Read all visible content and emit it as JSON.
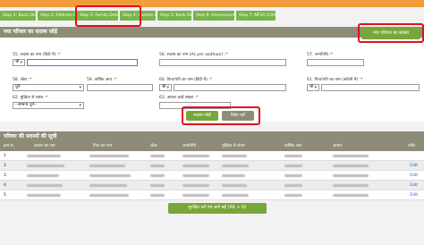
{
  "steps": [
    "Step 1: Basic Details",
    "Step 2: Address Details",
    "Step 3: Family Details",
    "Step 4: Income Details",
    "Step 5: Bank Details",
    "Step 6: Annexurement",
    "Step 7: NFSA Criteria"
  ],
  "form": {
    "title": "नया परिवार का सदस्य जोड़ें",
    "add_button": "नया परिवार का सदस्य",
    "f55_label": "55. सदस्य का नाम (हिंदी में) :*",
    "f55_select": "श्री",
    "f56_label": "56. सदस्य का नाम (As per aadhaar) :*",
    "f57_label": "57. जन्मतिथि :*",
    "f58_label": "58. जेंडर :*",
    "f58_value": "चुनें",
    "f59_label": "59. वार्षिक आय :*",
    "f60_label": "60. पिता/पति का नाम (हिंदी में) :*",
    "f60_select": "श्री",
    "f61_label": "61. पिता/पति का नाम (अंग्रेजी में) :*",
    "f61_select": "श्री",
    "f62_label": "62. मुखिया से संबंध :*",
    "f62_value": "--सम्बन्ध चुनें--",
    "f63_label": "63. आधार कार्ड संख्या :*",
    "submit": "सदस्य जोड़ें",
    "reset": "रिसेट करें"
  },
  "list": {
    "title": "परिवार की सदस्यों की सूची",
    "headers": [
      "क्रम स.",
      "सदस्य का नाम",
      "पिता का नाम",
      "जेंडर",
      "जन्मतिथि",
      "मुखिया से संबंध",
      "वार्षिक आय",
      "आधार",
      "एडिट"
    ],
    "rows": [
      {
        "n": "1",
        "edit": ""
      },
      {
        "n": "2",
        "edit": "Edit"
      },
      {
        "n": "3",
        "edit": "Edit"
      },
      {
        "n": "4",
        "edit": "Edit"
      },
      {
        "n": "5",
        "edit": "Edit"
      }
    ],
    "next_button": "सुरक्षित करें एवं आगे बढ़ें (Alt + N)"
  }
}
